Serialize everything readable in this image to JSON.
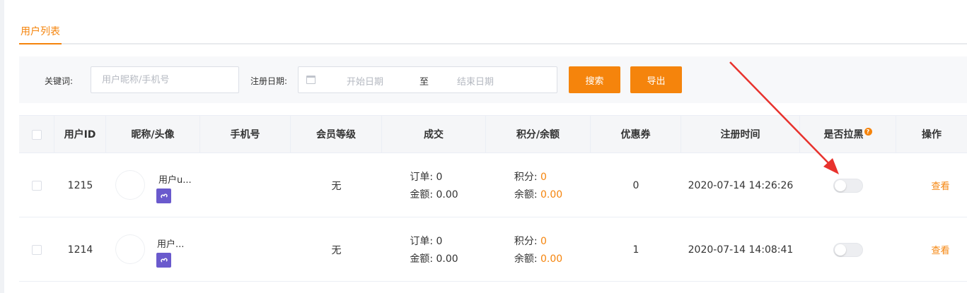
{
  "tabs": {
    "active": "用户列表"
  },
  "filter": {
    "keyword_label": "关键词:",
    "keyword_placeholder": "用户昵称/手机号",
    "date_label": "注册日期:",
    "date_start_placeholder": "开始日期",
    "date_separator": "至",
    "date_end_placeholder": "结束日期",
    "search_button": "搜索",
    "export_button": "导出"
  },
  "table": {
    "headers": [
      "用户ID",
      "昵称/头像",
      "手机号",
      "会员等级",
      "成交",
      "积分/余额",
      "优惠券",
      "注册时间",
      "是否拉黑",
      "操作"
    ],
    "help_badge": "?",
    "rows": [
      {
        "id": "1215",
        "nickname": "用户u...",
        "phone": "",
        "level": "无",
        "orders_label": "订单:",
        "orders": "0",
        "amount_label": "金额:",
        "amount": "0.00",
        "points_label": "积分:",
        "points": "0",
        "balance_label": "余额:",
        "balance": "0.00",
        "coupons": "0",
        "registered": "2020-07-14 14:26:26",
        "blacklisted": false,
        "action": "查看"
      },
      {
        "id": "1214",
        "nickname": "用户...",
        "phone": "",
        "level": "无",
        "orders_label": "订单:",
        "orders": "0",
        "amount_label": "金额:",
        "amount": "0.00",
        "points_label": "积分:",
        "points": "0",
        "balance_label": "余额:",
        "balance": "0.00",
        "coupons": "1",
        "registered": "2020-07-14 14:08:41",
        "blacklisted": false,
        "action": "查看"
      }
    ]
  },
  "colors": {
    "accent": "#f5840c",
    "annotation_arrow": "#e8322d",
    "mini_program_icon": "#6a5acd"
  },
  "icons": {
    "calendar": "calendar-icon",
    "mini_program": "mini-program-icon",
    "help": "help-icon"
  }
}
